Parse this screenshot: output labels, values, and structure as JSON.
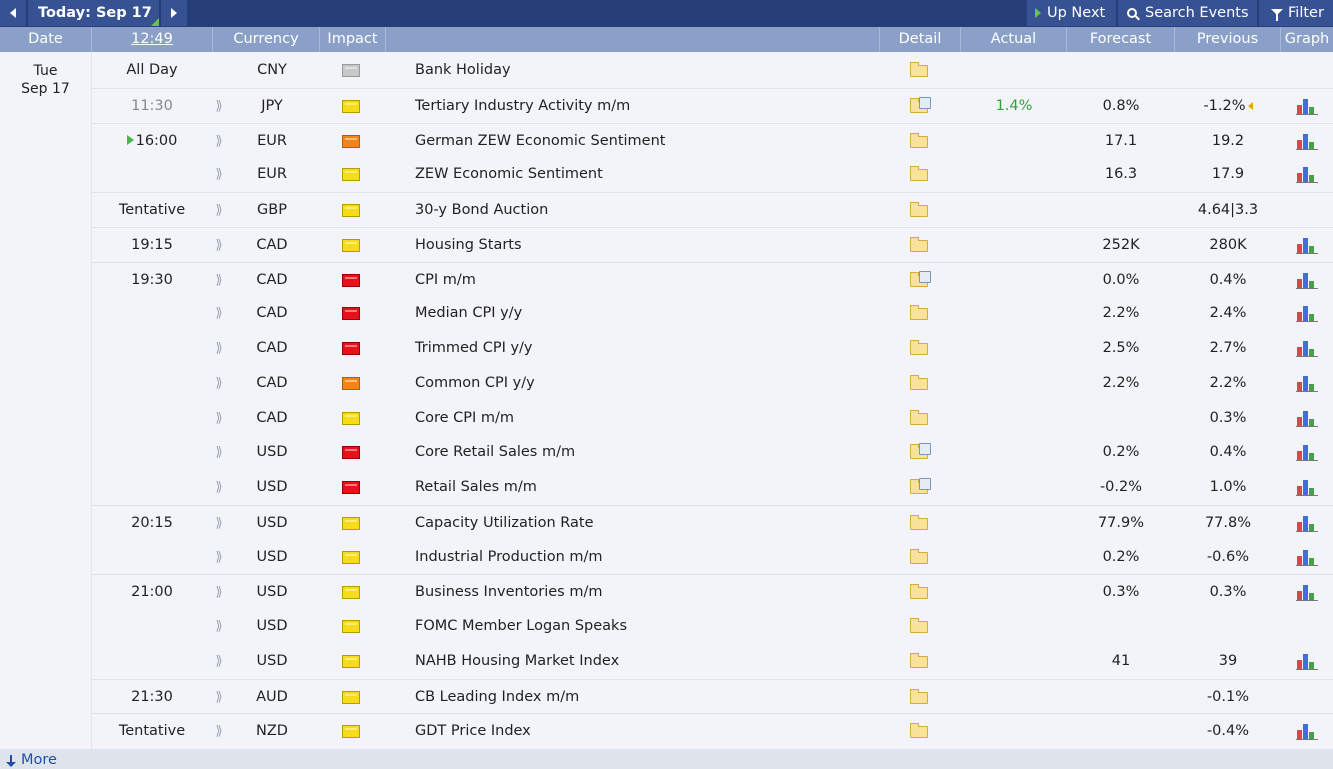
{
  "toolbar": {
    "today_label": "Today: Sep 17",
    "up_next_label": "Up Next",
    "search_label": "Search Events",
    "filter_label": "Filter"
  },
  "columns": {
    "date": "Date",
    "time": "12:49",
    "currency": "Currency",
    "impact": "Impact",
    "detail": "Detail",
    "actual": "Actual",
    "forecast": "Forecast",
    "previous": "Previous",
    "graph": "Graph"
  },
  "date": {
    "weekday": "Tue",
    "day": "Sep 17"
  },
  "impact_colors": {
    "gray": "#c8c8c8",
    "yellow": "#f7dc1a",
    "orange": "#f0851c",
    "red": "#e8101a"
  },
  "events": [
    {
      "time": "All Day",
      "currency": "CNY",
      "impact": "gray",
      "event": "Bank Holiday",
      "detail_icon": "folder-icon",
      "actual": "",
      "forecast": "",
      "previous": "",
      "graph": false,
      "sound": false
    },
    {
      "time": "11:30",
      "currency": "JPY",
      "impact": "yellow",
      "event": "Tertiary Industry Activity m/m",
      "detail_icon": "folder-news-icon",
      "actual": "1.4%",
      "forecast": "0.8%",
      "previous": "-1.2%",
      "graph": true,
      "sound": true
    },
    {
      "time": "16:00",
      "currency": "EUR",
      "impact": "orange",
      "event": "German ZEW Economic Sentiment",
      "detail_icon": "folder-icon",
      "actual": "",
      "forecast": "17.1",
      "previous": "19.2",
      "graph": true,
      "sound": true
    },
    {
      "time": "",
      "currency": "EUR",
      "impact": "yellow",
      "event": "ZEW Economic Sentiment",
      "detail_icon": "folder-icon",
      "actual": "",
      "forecast": "16.3",
      "previous": "17.9",
      "graph": true,
      "sound": true
    },
    {
      "time": "Tentative",
      "currency": "GBP",
      "impact": "yellow",
      "event": "30-y Bond Auction",
      "detail_icon": "folder-icon",
      "actual": "",
      "forecast": "",
      "previous": "4.64|3.3",
      "graph": false,
      "sound": true
    },
    {
      "time": "19:15",
      "currency": "CAD",
      "impact": "yellow",
      "event": "Housing Starts",
      "detail_icon": "folder-icon",
      "actual": "",
      "forecast": "252K",
      "previous": "280K",
      "graph": true,
      "sound": true
    },
    {
      "time": "19:30",
      "currency": "CAD",
      "impact": "red",
      "event": "CPI m/m",
      "detail_icon": "folder-news-icon",
      "actual": "",
      "forecast": "0.0%",
      "previous": "0.4%",
      "graph": true,
      "sound": true
    },
    {
      "time": "",
      "currency": "CAD",
      "impact": "red",
      "event": "Median CPI y/y",
      "detail_icon": "folder-icon",
      "actual": "",
      "forecast": "2.2%",
      "previous": "2.4%",
      "graph": true,
      "sound": true
    },
    {
      "time": "",
      "currency": "CAD",
      "impact": "red",
      "event": "Trimmed CPI y/y",
      "detail_icon": "folder-icon",
      "actual": "",
      "forecast": "2.5%",
      "previous": "2.7%",
      "graph": true,
      "sound": true
    },
    {
      "time": "",
      "currency": "CAD",
      "impact": "orange",
      "event": "Common CPI y/y",
      "detail_icon": "folder-icon",
      "actual": "",
      "forecast": "2.2%",
      "previous": "2.2%",
      "graph": true,
      "sound": true
    },
    {
      "time": "",
      "currency": "CAD",
      "impact": "yellow",
      "event": "Core CPI m/m",
      "detail_icon": "folder-icon",
      "actual": "",
      "forecast": "",
      "previous": "0.3%",
      "graph": true,
      "sound": true
    },
    {
      "time": "",
      "currency": "USD",
      "impact": "red",
      "event": "Core Retail Sales m/m",
      "detail_icon": "folder-news-icon",
      "actual": "",
      "forecast": "0.2%",
      "previous": "0.4%",
      "graph": true,
      "sound": true
    },
    {
      "time": "",
      "currency": "USD",
      "impact": "red",
      "event": "Retail Sales m/m",
      "detail_icon": "folder-news-icon",
      "actual": "",
      "forecast": "-0.2%",
      "previous": "1.0%",
      "graph": true,
      "sound": true
    },
    {
      "time": "20:15",
      "currency": "USD",
      "impact": "yellow",
      "event": "Capacity Utilization Rate",
      "detail_icon": "folder-icon",
      "actual": "",
      "forecast": "77.9%",
      "previous": "77.8%",
      "graph": true,
      "sound": true
    },
    {
      "time": "",
      "currency": "USD",
      "impact": "yellow",
      "event": "Industrial Production m/m",
      "detail_icon": "folder-icon",
      "actual": "",
      "forecast": "0.2%",
      "previous": "-0.6%",
      "graph": true,
      "sound": true
    },
    {
      "time": "21:00",
      "currency": "USD",
      "impact": "yellow",
      "event": "Business Inventories m/m",
      "detail_icon": "folder-icon",
      "actual": "",
      "forecast": "0.3%",
      "previous": "0.3%",
      "graph": true,
      "sound": true
    },
    {
      "time": "",
      "currency": "USD",
      "impact": "yellow",
      "event": "FOMC Member Logan Speaks",
      "detail_icon": "folder-icon",
      "actual": "",
      "forecast": "",
      "previous": "",
      "graph": false,
      "sound": true
    },
    {
      "time": "",
      "currency": "USD",
      "impact": "yellow",
      "event": "NAHB Housing Market Index",
      "detail_icon": "folder-icon",
      "actual": "",
      "forecast": "41",
      "previous": "39",
      "graph": true,
      "sound": true
    },
    {
      "time": "21:30",
      "currency": "AUD",
      "impact": "yellow",
      "event": "CB Leading Index m/m",
      "detail_icon": "folder-icon",
      "actual": "",
      "forecast": "",
      "previous": "-0.1%",
      "graph": false,
      "sound": true
    },
    {
      "time": "Tentative",
      "currency": "NZD",
      "impact": "yellow",
      "event": "GDT Price Index",
      "detail_icon": "folder-icon",
      "actual": "",
      "forecast": "",
      "previous": "-0.4%",
      "graph": true,
      "sound": true
    }
  ],
  "footer": {
    "more_label": "More"
  }
}
